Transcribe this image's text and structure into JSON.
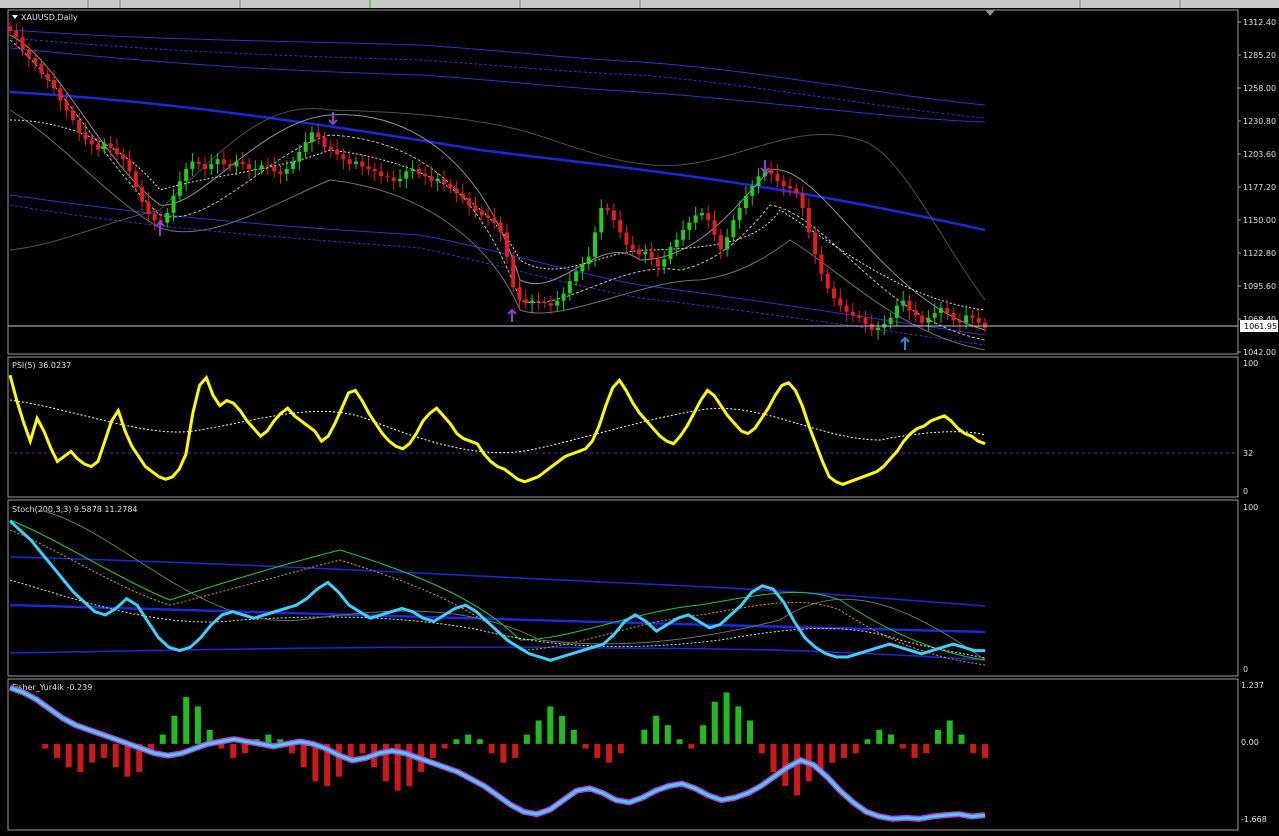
{
  "panels": {
    "main": {
      "title": "XAUUSD,Daily",
      "price_ticks": [
        "1312.40",
        "1285.20",
        "1258.00",
        "1230.80",
        "1203.60",
        "1177.20",
        "1150.00",
        "1122.80",
        "1095.60",
        "1068.40",
        "1042.00"
      ],
      "current_price": "1061.95"
    },
    "psi": {
      "title": "PSI(5) 36.0237",
      "ticks": [
        "100",
        "32",
        "0"
      ]
    },
    "stoch": {
      "title": "Stoch(200,3,3) 9.5878 11.2784",
      "ticks": [
        "100",
        "0"
      ]
    },
    "fisher": {
      "title": "Fisher_Yur4ik -0.239",
      "ticks": [
        "1.237",
        "0.00",
        "-1.668"
      ]
    }
  },
  "colors": {
    "background": "#000000",
    "bull": "#22cc22",
    "bear": "#e02020",
    "psi_line": "#ffff00",
    "stoch_line": "#40d0ff",
    "ma_blue": "#1a2ad8",
    "hist_pos": "#22bb22",
    "hist_neg": "#cc1a1a",
    "current_price_box": "#ffffff"
  },
  "chart_data": [
    {
      "type": "candlestick",
      "title": "XAUUSD,Daily",
      "ylim": [
        1042.0,
        1312.4
      ],
      "close": [
        1305,
        1300,
        1290,
        1283,
        1278,
        1270,
        1265,
        1258,
        1248,
        1240,
        1232,
        1222,
        1216,
        1212,
        1208,
        1213,
        1209,
        1204,
        1200,
        1190,
        1177,
        1165,
        1155,
        1150,
        1148,
        1156,
        1170,
        1182,
        1192,
        1198,
        1196,
        1192,
        1196,
        1200,
        1196,
        1194,
        1198,
        1196,
        1192,
        1192,
        1195,
        1194,
        1190,
        1188,
        1192,
        1198,
        1206,
        1214,
        1222,
        1218,
        1210,
        1208,
        1204,
        1200,
        1196,
        1198,
        1194,
        1192,
        1190,
        1186,
        1185,
        1182,
        1184,
        1190,
        1192,
        1188,
        1186,
        1182,
        1184,
        1180,
        1176,
        1172,
        1168,
        1162,
        1158,
        1154,
        1152,
        1148,
        1140,
        1120,
        1095,
        1085,
        1082,
        1084,
        1083,
        1082,
        1080,
        1084,
        1090,
        1100,
        1108,
        1114,
        1120,
        1140,
        1160,
        1158,
        1150,
        1140,
        1130,
        1126,
        1122,
        1124,
        1118,
        1112,
        1118,
        1128,
        1134,
        1142,
        1148,
        1154,
        1156,
        1150,
        1138,
        1126,
        1136,
        1150,
        1160,
        1170,
        1178,
        1186,
        1192,
        1188,
        1182,
        1178,
        1176,
        1172,
        1160,
        1140,
        1122,
        1106,
        1094,
        1086,
        1080,
        1075,
        1072,
        1070,
        1065,
        1060,
        1062,
        1065,
        1070,
        1080,
        1084,
        1076,
        1072,
        1066,
        1070,
        1074,
        1078,
        1074,
        1068,
        1066,
        1072,
        1070,
        1066,
        1062
      ]
    },
    {
      "type": "line",
      "title": "PSI(5) 36.0237",
      "ylim": [
        0,
        100
      ],
      "reference": 32,
      "values": [
        92,
        72,
        55,
        40,
        58,
        48,
        35,
        24,
        28,
        32,
        26,
        22,
        20,
        24,
        40,
        56,
        64,
        48,
        36,
        28,
        20,
        16,
        12,
        10,
        12,
        18,
        30,
        62,
        84,
        90,
        76,
        68,
        72,
        70,
        64,
        56,
        50,
        44,
        48,
        56,
        62,
        66,
        60,
        56,
        52,
        48,
        40,
        44,
        54,
        66,
        78,
        80,
        72,
        62,
        54,
        46,
        40,
        36,
        34,
        38,
        46,
        56,
        62,
        66,
        60,
        54,
        46,
        42,
        40,
        38,
        30,
        24,
        20,
        18,
        14,
        10,
        8,
        10,
        12,
        16,
        20,
        24,
        28,
        30,
        32,
        34,
        40,
        52,
        68,
        82,
        88,
        80,
        70,
        62,
        56,
        50,
        44,
        40,
        38,
        44,
        52,
        62,
        72,
        80,
        76,
        68,
        60,
        54,
        48,
        46,
        50,
        58,
        66,
        76,
        84,
        86,
        80,
        68,
        52,
        38,
        24,
        12,
        8,
        6,
        8,
        10,
        12,
        14,
        16,
        20,
        26,
        32,
        40,
        46,
        50,
        52,
        56,
        58,
        60,
        56,
        50,
        46,
        44,
        40,
        38
      ]
    },
    {
      "type": "line",
      "title": "Stoch(200,3,3) 9.5878 11.2784",
      "ylim": [
        0,
        100
      ],
      "values": [
        92,
        86,
        80,
        72,
        64,
        56,
        48,
        42,
        36,
        34,
        38,
        44,
        40,
        30,
        20,
        14,
        12,
        14,
        20,
        28,
        34,
        36,
        34,
        32,
        34,
        36,
        38,
        40,
        44,
        50,
        54,
        48,
        40,
        36,
        32,
        34,
        36,
        38,
        36,
        32,
        30,
        34,
        38,
        40,
        36,
        30,
        24,
        18,
        14,
        10,
        8,
        6,
        8,
        10,
        12,
        14,
        16,
        22,
        30,
        34,
        30,
        24,
        28,
        32,
        34,
        30,
        26,
        28,
        34,
        40,
        48,
        52,
        50,
        42,
        30,
        20,
        14,
        10,
        8,
        8,
        10,
        12,
        14,
        16,
        14,
        12,
        10,
        12,
        14,
        16,
        14,
        12,
        12
      ]
    },
    {
      "type": "line",
      "title": "Fisher_Yur4ik -0.239",
      "ylim": [
        -1.668,
        1.237
      ],
      "values": [
        1.2,
        1.1,
        0.95,
        0.75,
        0.55,
        0.4,
        0.3,
        0.2,
        0.1,
        0.0,
        -0.1,
        -0.2,
        -0.25,
        -0.2,
        -0.1,
        0.0,
        0.05,
        0.1,
        0.05,
        0.0,
        -0.05,
        0.0,
        0.05,
        0.0,
        -0.1,
        -0.25,
        -0.35,
        -0.3,
        -0.2,
        -0.15,
        -0.2,
        -0.3,
        -0.4,
        -0.5,
        -0.6,
        -0.75,
        -0.9,
        -1.1,
        -1.3,
        -1.45,
        -1.5,
        -1.4,
        -1.2,
        -1.0,
        -0.95,
        -1.05,
        -1.2,
        -1.25,
        -1.15,
        -1.0,
        -0.9,
        -0.85,
        -0.95,
        -1.1,
        -1.2,
        -1.15,
        -1.05,
        -0.9,
        -0.7,
        -0.5,
        -0.35,
        -0.45,
        -0.7,
        -1.0,
        -1.25,
        -1.45,
        -1.55,
        -1.6,
        -1.58,
        -1.6,
        -1.55,
        -1.52,
        -1.5,
        -1.55,
        -1.52
      ]
    },
    {
      "type": "bar",
      "title": "Fisher_Yur4ik histogram",
      "ylim": [
        -1.668,
        1.237
      ],
      "values": [
        0,
        0,
        0,
        -0.1,
        -0.3,
        -0.5,
        -0.6,
        -0.4,
        -0.3,
        -0.5,
        -0.7,
        -0.6,
        -0.2,
        0.2,
        0.6,
        1.0,
        0.8,
        0.3,
        -0.1,
        -0.3,
        -0.2,
        0.1,
        0.2,
        0.1,
        -0.2,
        -0.5,
        -0.8,
        -0.9,
        -0.7,
        -0.4,
        -0.2,
        -0.5,
        -0.8,
        -1.0,
        -0.9,
        -0.6,
        -0.3,
        -0.1,
        0.1,
        0.2,
        0.1,
        -0.2,
        -0.4,
        -0.3,
        0.2,
        0.5,
        0.8,
        0.6,
        0.3,
        -0.1,
        -0.3,
        -0.4,
        -0.2,
        0.0,
        0.3,
        0.6,
        0.4,
        0.1,
        -0.1,
        0.4,
        0.9,
        1.1,
        0.8,
        0.5,
        -0.2,
        -0.6,
        -0.9,
        -1.1,
        -0.8,
        -0.6,
        -0.4,
        -0.3,
        -0.2,
        0.1,
        0.3,
        0.2,
        -0.1,
        -0.3,
        -0.2,
        0.3,
        0.5,
        0.2,
        -0.2,
        -0.3
      ]
    }
  ]
}
